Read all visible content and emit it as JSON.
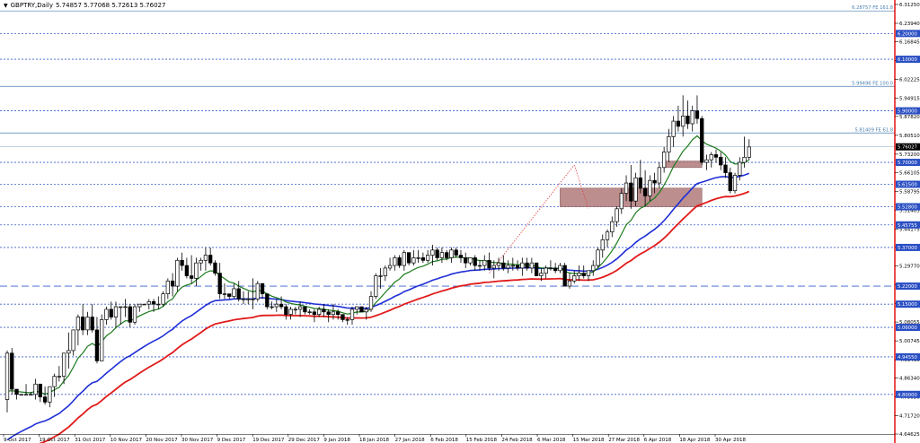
{
  "header": {
    "symbol": "GBPTRY,Daily",
    "ohlc": "5.74857 5.77068 5.72613 5.76027",
    "menu_icon": "triangle-down-icon"
  },
  "colors": {
    "grid": "#3a5fcd",
    "candle": "#000000",
    "ma_fast": "#1a7a1a",
    "ma_mid": "#1f2fd6",
    "ma_slow": "#e11a1a",
    "zone": "#b07a7a",
    "fib": "#4a7fb0",
    "vline": "#e00000",
    "level_tag": "#2a4fc4",
    "price_tag": "#000000"
  },
  "chart_data": {
    "type": "candlestick",
    "title": "GBPTRY,Daily",
    "ylim": [
      4.6462,
      6.3125
    ],
    "y_ticks": [
      "6.31250",
      "6.23940",
      "6.16845",
      "6.09535",
      "6.02225",
      "5.94915",
      "5.87820",
      "5.80510",
      "5.73200",
      "5.66105",
      "5.58795",
      "5.51485",
      "5.44175",
      "5.37080",
      "5.29770",
      "5.22460",
      "5.15150",
      "5.08055",
      "5.00745",
      "4.93435",
      "4.86340",
      "4.79030",
      "4.71720",
      "4.64625"
    ],
    "x_labels": [
      "9 Oct 2017",
      "19 Oct 2017",
      "31 Oct 2017",
      "10 Nov 2017",
      "20 Nov 2017",
      "30 Nov 2017",
      "9 Dec 2017",
      "19 Dec 2017",
      "29 Dec 2017",
      "9 Jan 2018",
      "18 Jan 2018",
      "27 Jan 2018",
      "6 Feb 2018",
      "15 Feb 2018",
      "24 Feb 2018",
      "6 Mar 2018",
      "15 Mar 2018",
      "27 Mar 2018",
      "6 Apr 2018",
      "18 Apr 2018",
      "30 Apr 2018"
    ],
    "levels": [
      {
        "value": 6.2,
        "label": "6.20000"
      },
      {
        "value": 6.1,
        "label": "6.10000"
      },
      {
        "value": 5.9,
        "label": "5.90000"
      },
      {
        "value": 5.7,
        "label": "5.70000"
      },
      {
        "value": 5.615,
        "label": "5.61500"
      },
      {
        "value": 5.528,
        "label": "5.52800"
      },
      {
        "value": 5.45755,
        "label": "5.45755"
      },
      {
        "value": 5.37,
        "label": "5.37000"
      },
      {
        "value": 5.22,
        "label": "5.22000"
      },
      {
        "value": 5.15,
        "label": "5.15000"
      },
      {
        "value": 5.06,
        "label": "5.06000"
      },
      {
        "value": 4.9455,
        "label": "4.94550"
      },
      {
        "value": 4.8,
        "label": "4.80000"
      }
    ],
    "fib_levels": [
      {
        "value": 6.28757,
        "label": "6.28757 FE 161.8"
      },
      {
        "value": 5.99496,
        "label": "5.99496 FE 100.0"
      },
      {
        "value": 5.81409,
        "label": "5.81409 FE 61.8"
      }
    ],
    "current_price": {
      "value": 5.76027,
      "label": "5.76027"
    },
    "zones": [
      {
        "from_bar": 117,
        "to_bar": 147,
        "low": 5.528,
        "high": 5.6
      },
      {
        "from_bar": 139,
        "to_bar": 147,
        "low": 5.68,
        "high": 5.705
      }
    ],
    "dotted_lines": [
      {
        "from_bar": 102,
        "from_value": 5.27,
        "to_bar": 120,
        "to_value": 5.69
      },
      {
        "from_bar": 120,
        "from_value": 5.69,
        "to_bar": 123,
        "to_value": 5.52
      }
    ],
    "candles": [
      [
        4.78,
        4.97,
        4.73,
        4.96
      ],
      [
        4.96,
        4.98,
        4.8,
        4.82
      ],
      [
        4.82,
        4.82,
        4.78,
        4.8
      ],
      [
        4.8,
        4.8,
        4.8,
        4.8
      ],
      [
        4.8,
        4.84,
        4.8,
        4.8
      ],
      [
        4.8,
        4.81,
        4.8,
        4.8
      ],
      [
        4.8,
        4.86,
        4.78,
        4.84
      ],
      [
        4.84,
        4.84,
        4.77,
        4.79
      ],
      [
        4.79,
        4.83,
        4.76,
        4.77
      ],
      [
        4.77,
        4.83,
        4.75,
        4.83
      ],
      [
        4.83,
        4.88,
        4.79,
        4.87
      ],
      [
        4.87,
        4.91,
        4.85,
        4.87
      ],
      [
        4.87,
        4.96,
        4.84,
        4.96
      ],
      [
        4.96,
        5.04,
        4.9,
        4.97
      ],
      [
        4.97,
        5.05,
        4.95,
        5.05
      ],
      [
        5.05,
        5.11,
        4.99,
        5.1
      ],
      [
        5.1,
        5.15,
        5.03,
        5.05
      ],
      [
        5.05,
        5.12,
        5.03,
        5.1
      ],
      [
        5.1,
        5.15,
        5.04,
        5.05
      ],
      [
        5.05,
        5.1,
        4.92,
        4.93
      ],
      [
        4.93,
        5.11,
        4.93,
        5.09
      ],
      [
        5.09,
        5.14,
        5.07,
        5.13
      ],
      [
        5.13,
        5.16,
        5.09,
        5.1
      ],
      [
        5.1,
        5.16,
        5.06,
        5.14
      ],
      [
        5.14,
        5.14,
        5.07,
        5.14
      ],
      [
        5.14,
        5.17,
        5.1,
        5.14
      ],
      [
        5.14,
        5.15,
        5.06,
        5.08
      ],
      [
        5.08,
        5.15,
        5.07,
        5.14
      ],
      [
        5.14,
        5.15,
        5.12,
        5.15
      ],
      [
        5.15,
        5.15,
        5.15,
        5.15
      ],
      [
        5.15,
        5.17,
        5.13,
        5.16
      ],
      [
        5.16,
        5.17,
        5.12,
        5.15
      ],
      [
        5.15,
        5.18,
        5.13,
        5.15
      ],
      [
        5.15,
        5.2,
        5.14,
        5.19
      ],
      [
        5.19,
        5.25,
        5.17,
        5.24
      ],
      [
        5.24,
        5.27,
        5.18,
        5.22
      ],
      [
        5.22,
        5.33,
        5.2,
        5.32
      ],
      [
        5.32,
        5.35,
        5.28,
        5.3
      ],
      [
        5.3,
        5.33,
        5.25,
        5.26
      ],
      [
        5.26,
        5.34,
        5.23,
        5.25
      ],
      [
        5.25,
        5.33,
        5.22,
        5.31
      ],
      [
        5.31,
        5.33,
        5.28,
        5.32
      ],
      [
        5.32,
        5.37,
        5.28,
        5.34
      ],
      [
        5.34,
        5.37,
        5.3,
        5.31
      ],
      [
        5.31,
        5.32,
        5.26,
        5.27
      ],
      [
        5.27,
        5.31,
        5.17,
        5.19
      ],
      [
        5.19,
        5.23,
        5.17,
        5.19
      ],
      [
        5.19,
        5.19,
        5.17,
        5.18
      ],
      [
        5.18,
        5.23,
        5.17,
        5.21
      ],
      [
        5.21,
        5.24,
        5.16,
        5.17
      ],
      [
        5.17,
        5.2,
        5.15,
        5.17
      ],
      [
        5.17,
        5.2,
        5.15,
        5.17
      ],
      [
        5.17,
        5.25,
        5.13,
        5.17
      ],
      [
        5.17,
        5.24,
        5.16,
        5.23
      ],
      [
        5.23,
        5.23,
        5.17,
        5.19
      ],
      [
        5.19,
        5.19,
        5.13,
        5.14
      ],
      [
        5.14,
        5.16,
        5.13,
        5.14
      ],
      [
        5.14,
        5.17,
        5.12,
        5.15
      ],
      [
        5.15,
        5.18,
        5.13,
        5.14
      ],
      [
        5.14,
        5.15,
        5.09,
        5.11
      ],
      [
        5.11,
        5.14,
        5.09,
        5.13
      ],
      [
        5.13,
        5.14,
        5.11,
        5.13
      ],
      [
        5.13,
        5.16,
        5.1,
        5.14
      ],
      [
        5.14,
        5.14,
        5.11,
        5.12
      ],
      [
        5.12,
        5.13,
        5.11,
        5.12
      ],
      [
        5.12,
        5.13,
        5.08,
        5.11
      ],
      [
        5.11,
        5.14,
        5.1,
        5.13
      ],
      [
        5.13,
        5.15,
        5.1,
        5.12
      ],
      [
        5.12,
        5.13,
        5.08,
        5.11
      ],
      [
        5.11,
        5.15,
        5.09,
        5.12
      ],
      [
        5.12,
        5.13,
        5.09,
        5.11
      ],
      [
        5.11,
        5.11,
        5.08,
        5.09
      ],
      [
        5.09,
        5.1,
        5.07,
        5.09
      ],
      [
        5.09,
        5.14,
        5.07,
        5.13
      ],
      [
        5.13,
        5.14,
        5.11,
        5.14
      ],
      [
        5.14,
        5.14,
        5.12,
        5.12
      ],
      [
        5.12,
        5.14,
        5.09,
        5.13
      ],
      [
        5.13,
        5.2,
        5.12,
        5.18
      ],
      [
        5.18,
        5.27,
        5.17,
        5.26
      ],
      [
        5.26,
        5.29,
        5.21,
        5.26
      ],
      [
        5.26,
        5.3,
        5.24,
        5.29
      ],
      [
        5.29,
        5.33,
        5.28,
        5.3
      ],
      [
        5.3,
        5.34,
        5.28,
        5.33
      ],
      [
        5.33,
        5.34,
        5.29,
        5.3
      ],
      [
        5.3,
        5.36,
        5.28,
        5.35
      ],
      [
        5.35,
        5.35,
        5.3,
        5.31
      ],
      [
        5.31,
        5.36,
        5.3,
        5.33
      ],
      [
        5.33,
        5.36,
        5.31,
        5.33
      ],
      [
        5.33,
        5.35,
        5.31,
        5.32
      ],
      [
        5.32,
        5.36,
        5.31,
        5.34
      ],
      [
        5.34,
        5.38,
        5.3,
        5.36
      ],
      [
        5.36,
        5.37,
        5.32,
        5.33
      ],
      [
        5.33,
        5.37,
        5.31,
        5.35
      ],
      [
        5.35,
        5.36,
        5.32,
        5.33
      ],
      [
        5.33,
        5.37,
        5.31,
        5.36
      ],
      [
        5.36,
        5.37,
        5.33,
        5.34
      ],
      [
        5.34,
        5.36,
        5.31,
        5.33
      ],
      [
        5.33,
        5.35,
        5.29,
        5.31
      ],
      [
        5.31,
        5.33,
        5.3,
        5.33
      ],
      [
        5.33,
        5.34,
        5.28,
        5.3
      ],
      [
        5.3,
        5.32,
        5.28,
        5.3
      ],
      [
        5.3,
        5.34,
        5.28,
        5.32
      ],
      [
        5.32,
        5.35,
        5.28,
        5.29
      ],
      [
        5.29,
        5.32,
        5.25,
        5.3
      ],
      [
        5.3,
        5.33,
        5.28,
        5.31
      ],
      [
        5.31,
        5.34,
        5.28,
        5.29
      ],
      [
        5.29,
        5.32,
        5.27,
        5.3
      ],
      [
        5.3,
        5.33,
        5.28,
        5.3
      ],
      [
        5.3,
        5.32,
        5.28,
        5.29
      ],
      [
        5.29,
        5.33,
        5.26,
        5.31
      ],
      [
        5.31,
        5.33,
        5.28,
        5.29
      ],
      [
        5.29,
        5.33,
        5.27,
        5.31
      ],
      [
        5.31,
        5.31,
        5.26,
        5.26
      ],
      [
        5.26,
        5.29,
        5.24,
        5.27
      ],
      [
        5.27,
        5.3,
        5.25,
        5.29
      ],
      [
        5.29,
        5.32,
        5.28,
        5.29
      ],
      [
        5.29,
        5.31,
        5.27,
        5.28
      ],
      [
        5.28,
        5.31,
        5.27,
        5.3
      ],
      [
        5.3,
        5.31,
        5.22,
        5.22
      ],
      [
        5.22,
        5.27,
        5.21,
        5.24
      ],
      [
        5.24,
        5.28,
        5.23,
        5.26
      ],
      [
        5.26,
        5.3,
        5.24,
        5.27
      ],
      [
        5.27,
        5.3,
        5.25,
        5.26
      ],
      [
        5.26,
        5.28,
        5.24,
        5.28
      ],
      [
        5.28,
        5.32,
        5.26,
        5.3
      ],
      [
        5.3,
        5.37,
        5.29,
        5.36
      ],
      [
        5.36,
        5.42,
        5.33,
        5.4
      ],
      [
        5.4,
        5.44,
        5.37,
        5.43
      ],
      [
        5.43,
        5.49,
        5.41,
        5.47
      ],
      [
        5.47,
        5.53,
        5.45,
        5.52
      ],
      [
        5.52,
        5.6,
        5.5,
        5.58
      ],
      [
        5.58,
        5.65,
        5.55,
        5.62
      ],
      [
        5.62,
        5.69,
        5.52,
        5.55
      ],
      [
        5.55,
        5.66,
        5.53,
        5.64
      ],
      [
        5.64,
        5.71,
        5.58,
        5.6
      ],
      [
        5.6,
        5.67,
        5.53,
        5.57
      ],
      [
        5.57,
        5.65,
        5.55,
        5.63
      ],
      [
        5.63,
        5.66,
        5.58,
        5.62
      ],
      [
        5.62,
        5.7,
        5.6,
        5.68
      ],
      [
        5.68,
        5.76,
        5.66,
        5.74
      ],
      [
        5.74,
        5.83,
        5.7,
        5.8
      ],
      [
        5.8,
        5.88,
        5.76,
        5.86
      ],
      [
        5.86,
        5.92,
        5.82,
        5.84
      ],
      [
        5.84,
        5.96,
        5.8,
        5.88
      ],
      [
        5.88,
        5.94,
        5.83,
        5.85
      ],
      [
        5.85,
        5.92,
        5.82,
        5.9
      ],
      [
        5.9,
        5.96,
        5.85,
        5.87
      ],
      [
        5.87,
        5.88,
        5.69,
        5.7
      ],
      [
        5.7,
        5.73,
        5.67,
        5.71
      ],
      [
        5.71,
        5.74,
        5.68,
        5.73
      ],
      [
        5.73,
        5.75,
        5.7,
        5.72
      ],
      [
        5.72,
        5.74,
        5.67,
        5.69
      ],
      [
        5.69,
        5.72,
        5.64,
        5.66
      ],
      [
        5.66,
        5.68,
        5.58,
        5.59
      ],
      [
        5.59,
        5.66,
        5.58,
        5.65
      ],
      [
        5.65,
        5.72,
        5.63,
        5.7
      ],
      [
        5.7,
        5.8,
        5.68,
        5.72
      ],
      [
        5.72,
        5.79,
        5.71,
        5.76
      ]
    ]
  }
}
